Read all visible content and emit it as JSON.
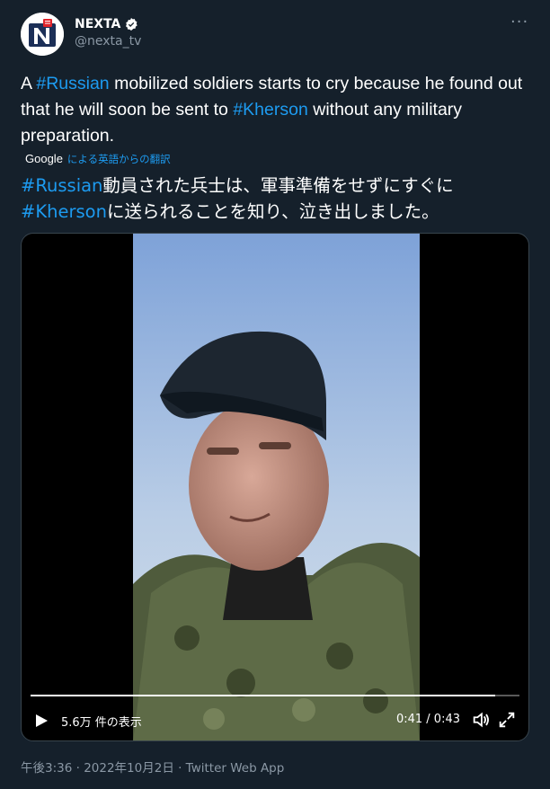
{
  "account": {
    "name": "NEXTA",
    "handle": "@nexta_tv",
    "verified": true,
    "avatar_icon": "nexta-logo-icon"
  },
  "more_icon": "more-horizontal-icon",
  "tweet": {
    "text_parts": [
      {
        "type": "text",
        "value": "A "
      },
      {
        "type": "hashtag",
        "value": "#Russian"
      },
      {
        "type": "text",
        "value": " mobilized soldiers starts to cry because he found out that he will soon be sent to "
      },
      {
        "type": "hashtag",
        "value": "#Kherson"
      },
      {
        "type": "text",
        "value": " without any military preparation."
      }
    ]
  },
  "translation": {
    "provider": "Google",
    "label": "による英語からの翻訳",
    "text_parts": [
      {
        "type": "hashtag",
        "value": "#Russian"
      },
      {
        "type": "text",
        "value": "動員された兵士は、軍事準備をせずにすぐに"
      },
      {
        "type": "hashtag",
        "value": "#Kherson"
      },
      {
        "type": "text",
        "value": "に送られることを知り、泣き出しました。"
      }
    ]
  },
  "video": {
    "views": "5.6万 件の表示",
    "time": "0:41 / 0:43",
    "progress": 0.95,
    "icons": {
      "play": "play-icon",
      "volume": "volume-icon",
      "fullscreen": "fullscreen-icon"
    }
  },
  "meta": "午後3:36 · 2022年10月2日 · Twitter Web App",
  "colors": {
    "background": "#15202b",
    "link": "#1d9bf0",
    "muted": "#8b98a5"
  }
}
